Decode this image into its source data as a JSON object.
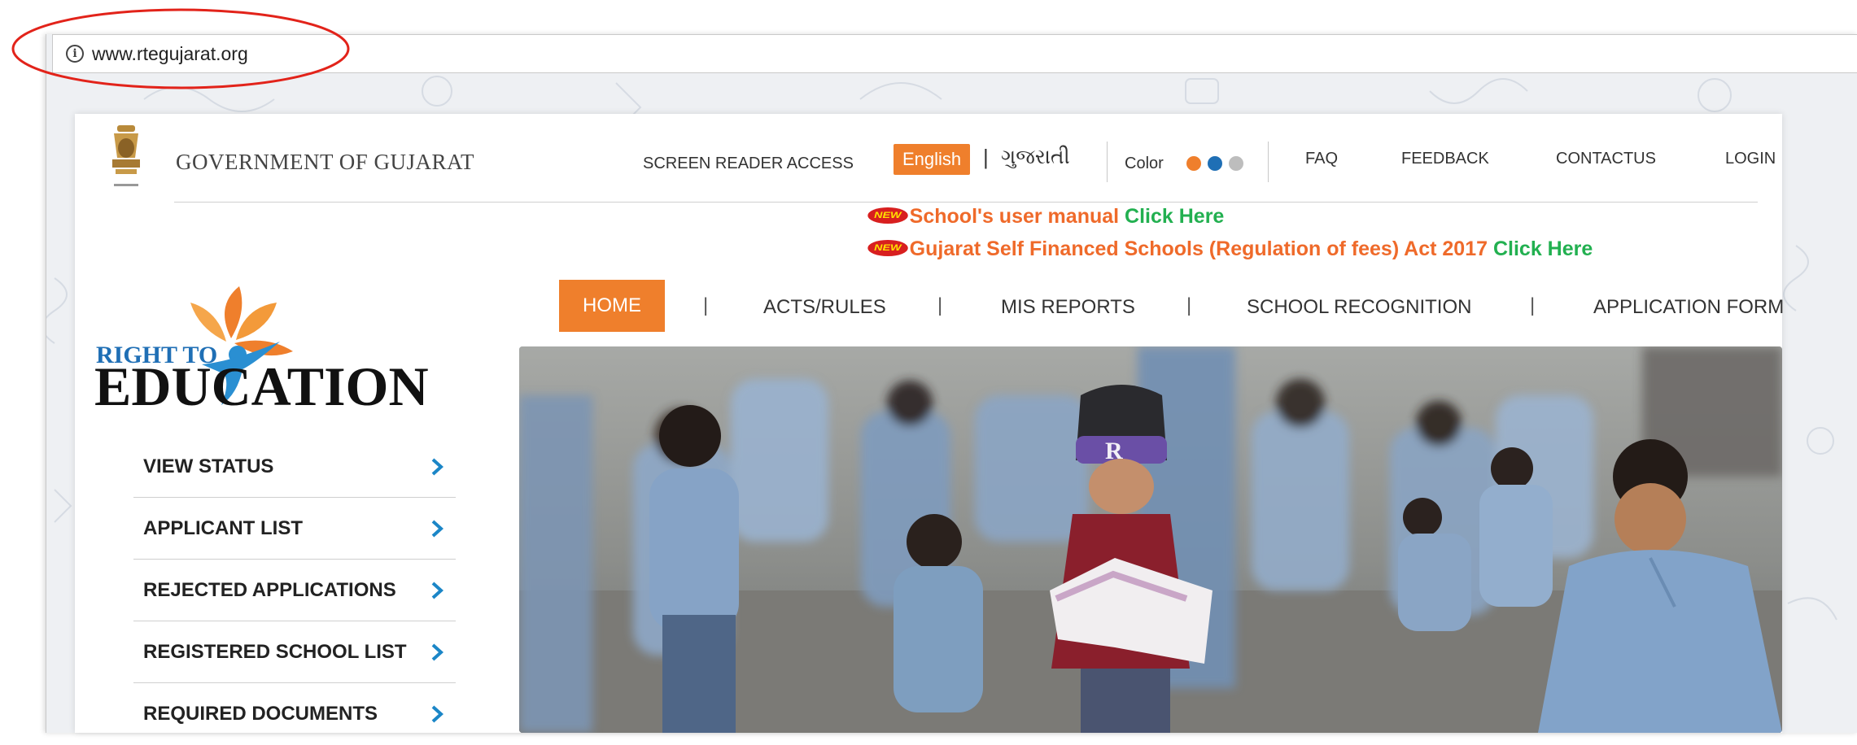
{
  "browser": {
    "url": "www.rtegujarat.org",
    "info_icon": "info-icon"
  },
  "header": {
    "gov_title": "GOVERNMENT OF GUJARAT",
    "screen_reader": "SCREEN READER ACCESS",
    "lang_english": "English",
    "lang_separator": "|",
    "lang_gujarati": "ગુજરાતી",
    "color_label": "Color",
    "color_options": [
      "#ef7f2c",
      "#1f6fb5",
      "#bdbdbd"
    ],
    "links": {
      "faq": "FAQ",
      "feedback": "FEEDBACK",
      "contact": "CONTACTUS",
      "login": "LOGIN"
    }
  },
  "announcements": [
    {
      "badge": "NEW",
      "text": "School's user manual ",
      "link": "Click Here"
    },
    {
      "badge": "NEW",
      "text": "Gujarat Self Financed Schools (Regulation of fees) Act 2017 ",
      "link": "Click Here"
    }
  ],
  "main_nav": {
    "items": [
      "HOME",
      "ACTS/RULES",
      "MIS REPORTS",
      "SCHOOL RECOGNITION",
      "APPLICATION FORM"
    ],
    "separator": "|"
  },
  "logo": {
    "line1": "RIGHT TO",
    "line2": "EDUCATION"
  },
  "side_menu": [
    {
      "label": "VIEW STATUS"
    },
    {
      "label": "APPLICANT LIST"
    },
    {
      "label": "REJECTED APPLICATIONS"
    },
    {
      "label": "REGISTERED SCHOOL LIST"
    },
    {
      "label": "REQUIRED DOCUMENTS"
    }
  ],
  "hero": {
    "cap_text": "R"
  },
  "colors": {
    "accent_orange": "#ef7f2c",
    "link_green": "#22b050",
    "side_chevron": "#1b86c7",
    "highlight_red": "#e2231a"
  }
}
